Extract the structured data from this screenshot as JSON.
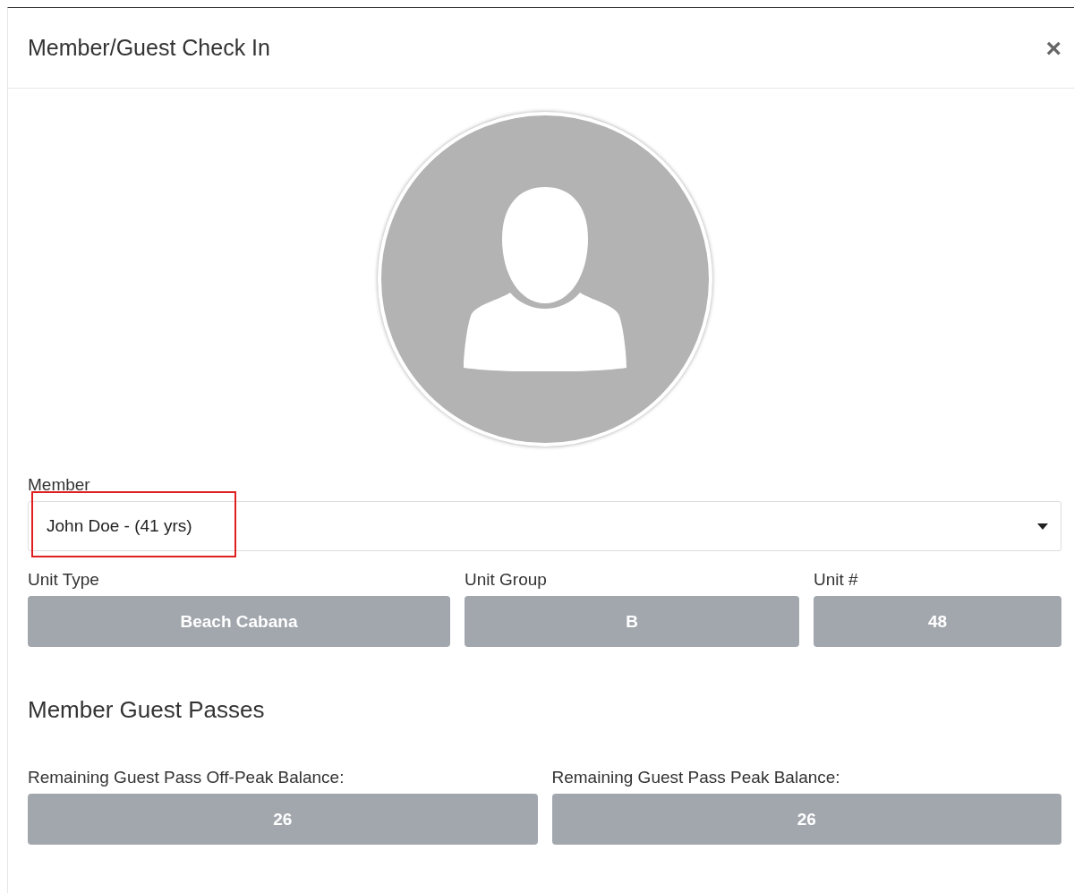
{
  "dialog": {
    "title": "Member/Guest Check In",
    "close": "×"
  },
  "member": {
    "label": "Member",
    "value": "John Doe - (41 yrs)",
    "highlighted": true
  },
  "unit_fields": [
    {
      "label": "Unit Type",
      "value": "Beach Cabana"
    },
    {
      "label": "Unit Group",
      "value": "B"
    },
    {
      "label": "Unit #",
      "value": "48"
    }
  ],
  "guest_passes": {
    "heading": "Member Guest Passes",
    "fields": [
      {
        "label": "Remaining Guest Pass Off-Peak Balance:",
        "value": "26"
      },
      {
        "label": "Remaining Guest Pass Peak Balance:",
        "value": "26"
      }
    ]
  }
}
